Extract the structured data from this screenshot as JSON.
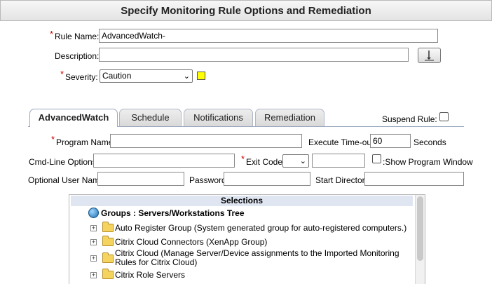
{
  "header": {
    "title": "Specify Monitoring Rule Options and Remediation"
  },
  "form": {
    "rule_name_label": "Rule Name:",
    "rule_name_value": "AdvancedWatch-",
    "description_label": "Description:",
    "description_value": "",
    "severity_label": "Severity:",
    "severity_value": "Caution",
    "severity_color": "#ffff00",
    "required_mark": "*"
  },
  "tabs": [
    {
      "label": "AdvancedWatch",
      "active": true
    },
    {
      "label": "Schedule",
      "active": false
    },
    {
      "label": "Notifications",
      "active": false
    },
    {
      "label": "Remediation",
      "active": false
    }
  ],
  "suspend_rule_label": "Suspend Rule:",
  "advanced": {
    "program_name_label": "Program Name:",
    "program_name_value": "",
    "execute_timeout_label": "Execute Time-out:",
    "execute_timeout_value": "60",
    "seconds_label": "Seconds",
    "cmdline_label": "Cmd-Line Options:",
    "exit_code_label": "Exit Code:",
    "show_window_label": ":Show Program Window",
    "user_label": "Optional User Name:",
    "password_label": "Password:",
    "start_dir_label": "Start Directory:"
  },
  "selections": {
    "header": "Selections",
    "root": "Groups : Servers/Workstations Tree",
    "items": [
      "Auto Register Group (System generated group for auto-registered computers.)",
      "Citrix Cloud Connectors (XenApp Group)",
      "Citrix Cloud (Manage Server/Device assignments to the Imported Monitoring Rules for Citrix Cloud)",
      "Citrix Role Servers"
    ]
  }
}
